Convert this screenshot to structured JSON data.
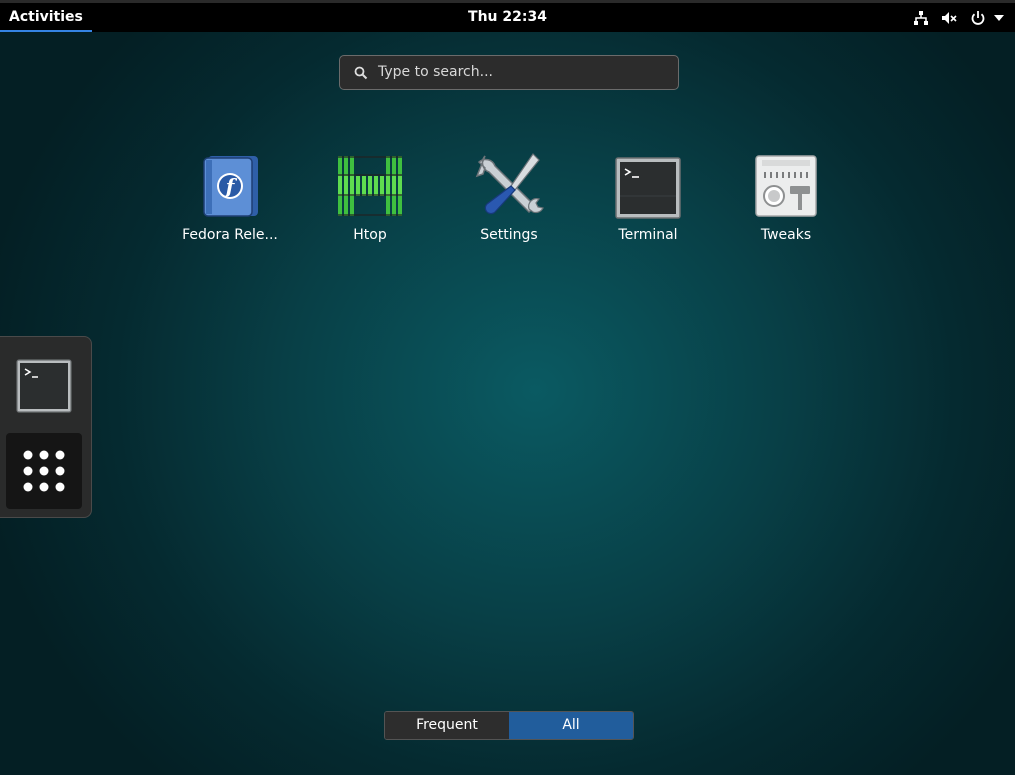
{
  "topbar": {
    "activities": "Activities",
    "clock": "Thu 22:34",
    "icons": [
      "network-icon",
      "volume-muted-icon",
      "power-icon",
      "menu-arrow-icon"
    ]
  },
  "search": {
    "placeholder": "Type to search..."
  },
  "apps": [
    {
      "label": "Fedora Rele...",
      "icon": "fedora-book-icon"
    },
    {
      "label": "Htop",
      "icon": "htop-icon"
    },
    {
      "label": "Settings",
      "icon": "settings-tools-icon"
    },
    {
      "label": "Terminal",
      "icon": "terminal-icon"
    },
    {
      "label": "Tweaks",
      "icon": "tweaks-icon"
    }
  ],
  "dash": {
    "items": [
      "terminal-icon",
      "show-applications-icon"
    ]
  },
  "view_switch": {
    "frequent": "Frequent",
    "all": "All",
    "selected": "All"
  },
  "colors": {
    "accent": "#215d9c",
    "activities_underline": "#3584e4",
    "topbar": "#000000"
  }
}
